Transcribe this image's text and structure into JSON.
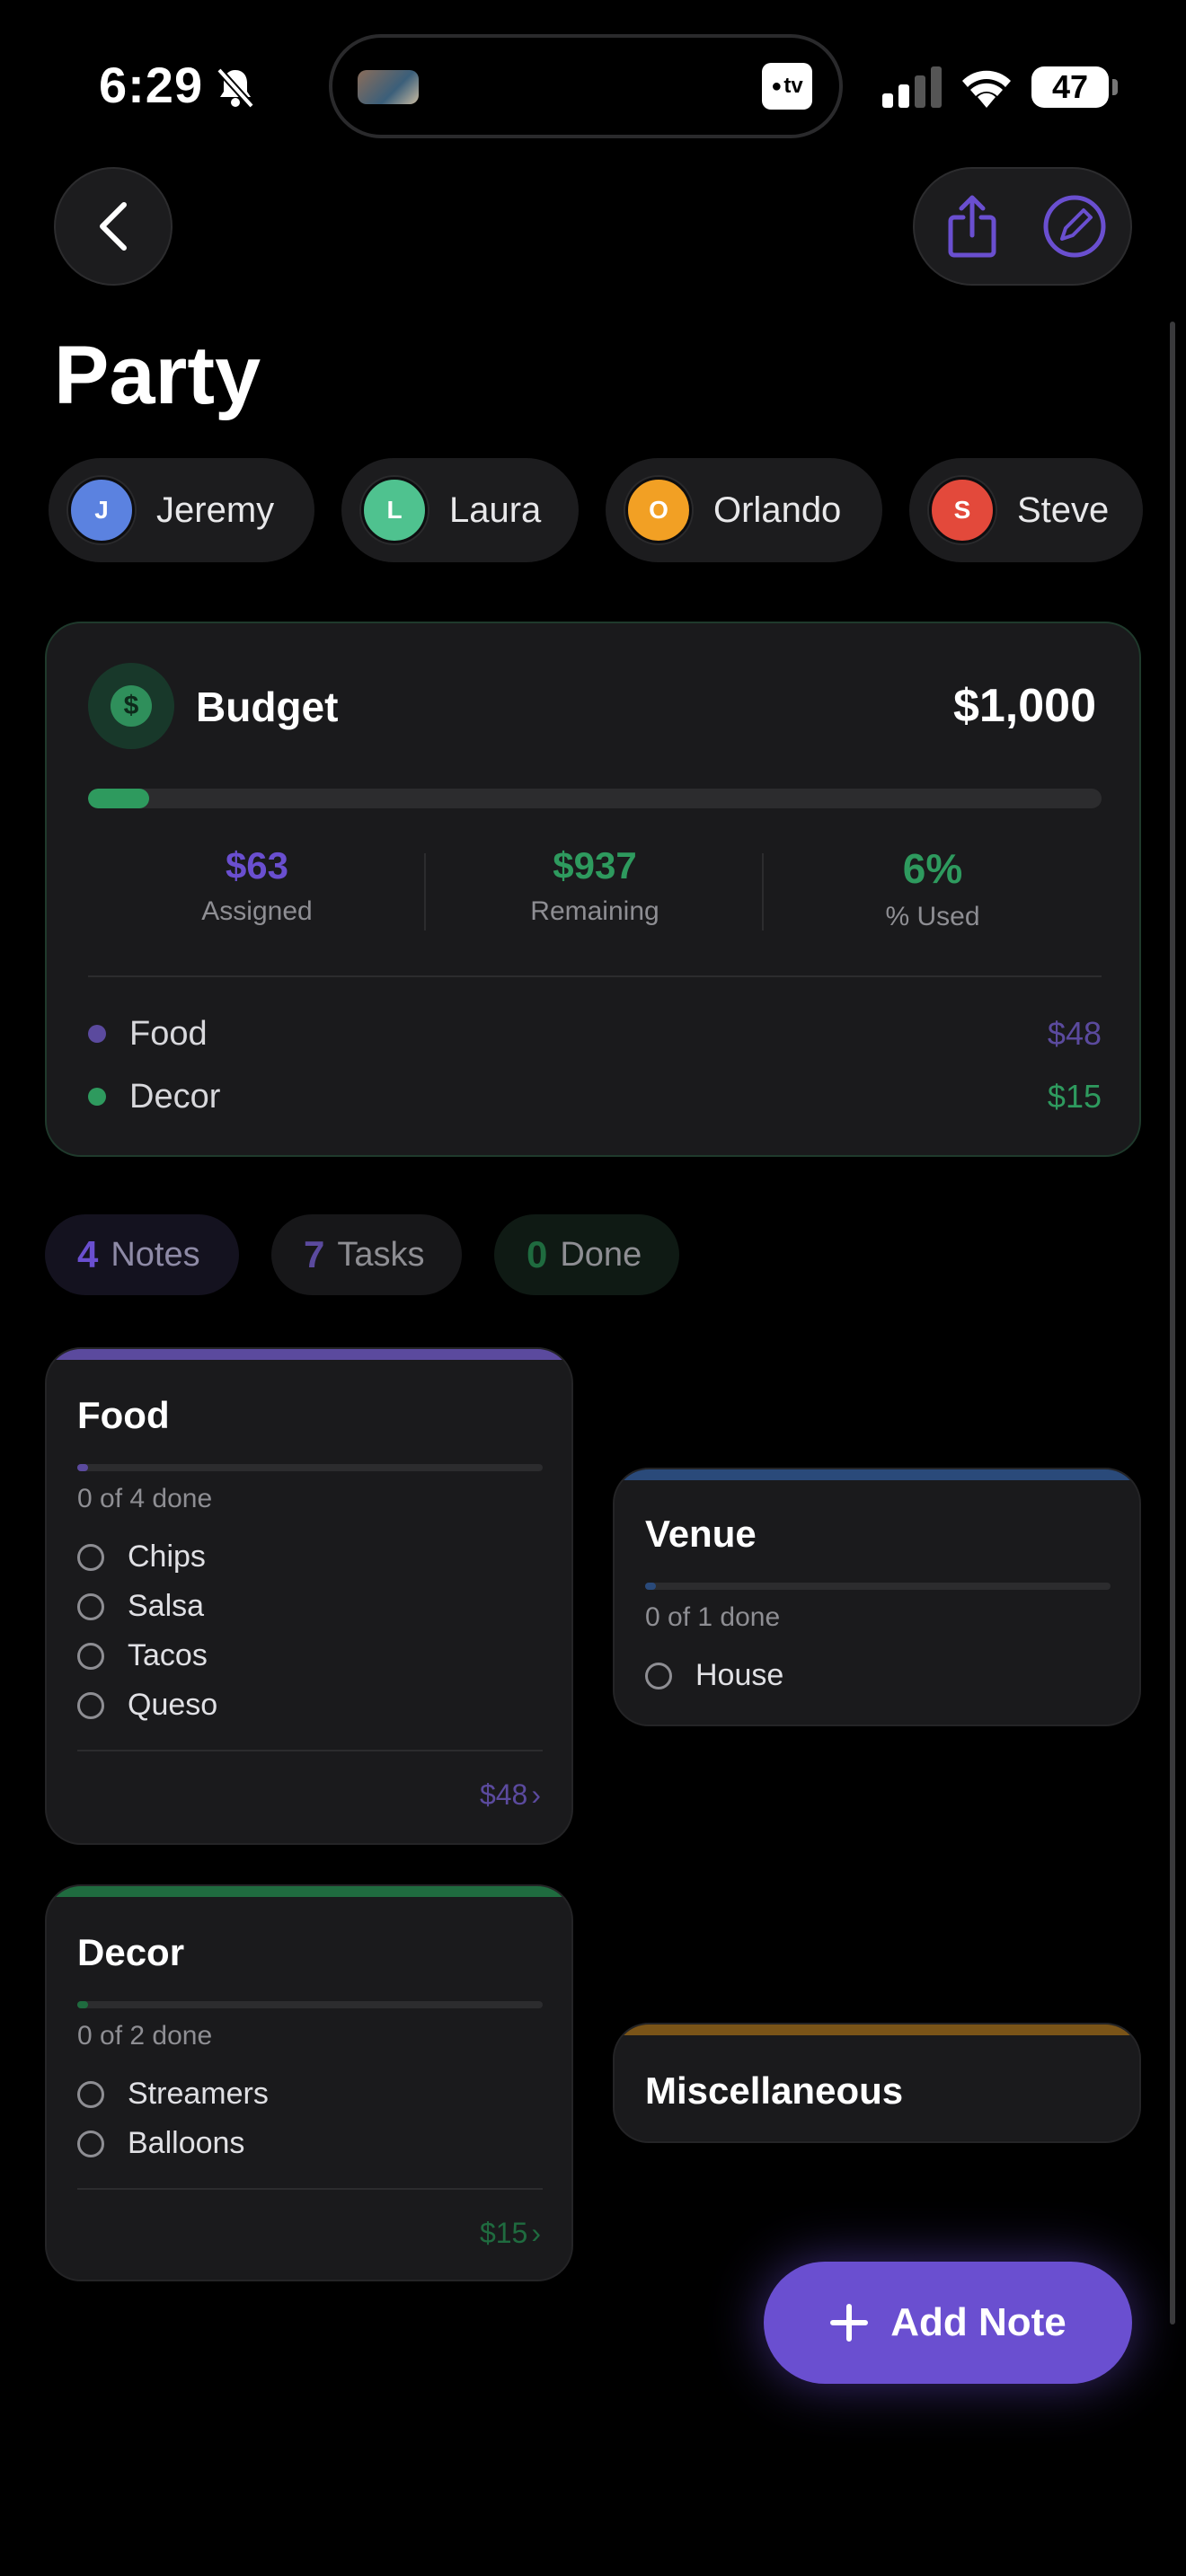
{
  "status_bar": {
    "time": "6:29",
    "tv_label": "tv",
    "battery": "47"
  },
  "page": {
    "title": "Party"
  },
  "members": [
    {
      "initial": "J",
      "name": "Jeremy",
      "color": "#5b82e0"
    },
    {
      "initial": "L",
      "name": "Laura",
      "color": "#4fc28f"
    },
    {
      "initial": "O",
      "name": "Orlando",
      "color": "#f2a024"
    },
    {
      "initial": "S",
      "name": "Steve",
      "color": "#e3493b"
    }
  ],
  "budget": {
    "label": "Budget",
    "total": "$1,000",
    "progress_fraction": 0.06,
    "stats": [
      {
        "value": "$63",
        "label": "Assigned",
        "color": "#6a4fd0"
      },
      {
        "value": "$937",
        "label": "Remaining",
        "color": "#2e9a5e"
      },
      {
        "value": "6%",
        "label": "% Used",
        "color": "#2e9a5e"
      }
    ],
    "categories": [
      {
        "name": "Food",
        "amount": "$48",
        "color": "#5b4a9e"
      },
      {
        "name": "Decor",
        "amount": "$15",
        "color": "#2e9a5e"
      }
    ]
  },
  "counters": {
    "notes": {
      "count": "4",
      "label": "Notes"
    },
    "tasks": {
      "count": "7",
      "label": "Tasks"
    },
    "done": {
      "count": "0",
      "label": "Done"
    }
  },
  "notes": {
    "food": {
      "title": "Food",
      "progress": "0 of 4 done",
      "items": [
        "Chips",
        "Salsa",
        "Tacos",
        "Queso"
      ],
      "amount": "$48",
      "accent": "#5b4a9e"
    },
    "venue": {
      "title": "Venue",
      "progress": "0 of 1 done",
      "items": [
        "House"
      ],
      "accent": "#2a4a7a"
    },
    "decor": {
      "title": "Decor",
      "progress": "0 of 2 done",
      "items": [
        "Streamers",
        "Balloons"
      ],
      "amount": "$15",
      "accent": "#1f6b3f"
    },
    "misc": {
      "title": "Miscellaneous",
      "accent": "#7a5418"
    }
  },
  "fab": {
    "label": "Add Note"
  }
}
